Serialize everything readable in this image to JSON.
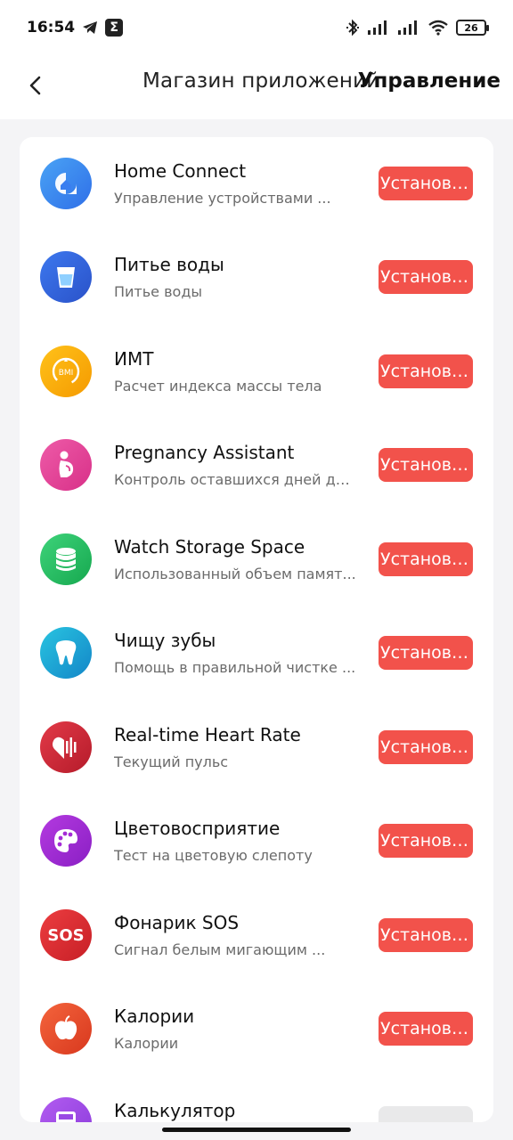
{
  "status_bar": {
    "time": "16:54",
    "sigma": "Σ",
    "battery": "26"
  },
  "header": {
    "title": "Магазин приложений",
    "manage": "Управление"
  },
  "colors": {
    "install_button": "#f2524b",
    "text_primary": "#111111",
    "text_secondary": "#6b6b6b"
  },
  "apps": [
    {
      "name": "Home Connect",
      "desc": "Управление устройствами ...",
      "button": "Установить",
      "icon": "home-connect-icon"
    },
    {
      "name": "Питье воды",
      "desc": "Питье воды",
      "button": "Установить",
      "icon": "water-glass-icon"
    },
    {
      "name": "ИМТ",
      "desc": "Расчет индекса массы тела",
      "button": "Установить",
      "icon": "bmi-gauge-icon"
    },
    {
      "name": "Pregnancy Assistant",
      "desc": "Контроль оставшихся дней до ...",
      "button": "Установить",
      "icon": "pregnancy-icon"
    },
    {
      "name": "Watch Storage Space",
      "desc": "Использованный объем памят...",
      "button": "Установить",
      "icon": "storage-database-icon"
    },
    {
      "name": "Чищу зубы",
      "desc": "Помощь в правильной чистке ...",
      "button": "Установить",
      "icon": "tooth-icon"
    },
    {
      "name": "Real-time Heart Rate",
      "desc": "Текущий пульс",
      "button": "Установить",
      "icon": "heart-rate-icon"
    },
    {
      "name": "Цветовосприятие",
      "desc": "Тест на цветовую слепоту",
      "button": "Установить",
      "icon": "palette-icon"
    },
    {
      "name": "Фонарик SOS",
      "desc": "Сигнал белым мигающим ...",
      "button": "Установить",
      "icon": "sos-icon",
      "icon_text": "SOS"
    },
    {
      "name": "Калории",
      "desc": "Калории",
      "button": "Установить",
      "icon": "apple-icon"
    },
    {
      "name": "Калькулятор",
      "desc": "",
      "button": "",
      "icon": "calculator-icon"
    }
  ]
}
